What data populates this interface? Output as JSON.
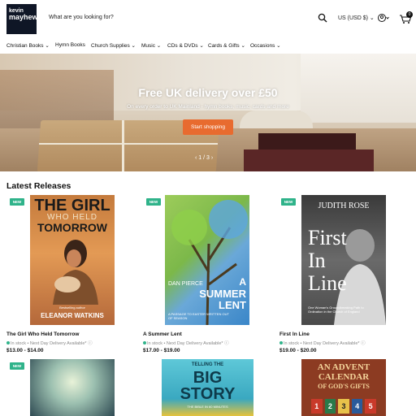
{
  "header": {
    "logo_lines": [
      "kevin",
      "mayhew"
    ],
    "search_placeholder": "What are you looking for?",
    "currency": "US (USD $)",
    "cart_count": "0"
  },
  "nav": [
    {
      "label": "Christian Books ⌄"
    },
    {
      "label": "Hymn Books"
    },
    {
      "label": "Church Supplies ⌄"
    },
    {
      "label": "Music ⌄"
    },
    {
      "label": "CDs & DVDs ⌄"
    },
    {
      "label": "Cards & Gifts ⌄"
    },
    {
      "label": "Occasions ⌄"
    }
  ],
  "hero": {
    "title": "Free UK delivery over £50",
    "subtitle": "On every order to UK Mainland - hymn books, music, cards and more",
    "button": "Start shopping",
    "pager": "1 / 3"
  },
  "latest_releases": {
    "title": "Latest Releases",
    "products": [
      {
        "badge": "NEW",
        "title": "The Girl Who Held Tomorrow",
        "stock": "In stock • Next Day Delivery Available*",
        "price": "$13.00 - $14.00",
        "cover": {
          "line1": "THE GIRL",
          "line2": "WHO HELD",
          "line3": "TOMORROW",
          "author": "ELEANOR WATKINS",
          "tagline": "Bestselling author"
        }
      },
      {
        "badge": "NEW",
        "title": "A Summer Lent",
        "stock": "In stock • Next Day Delivery Available*",
        "price": "$17.00 - $19.00",
        "cover": {
          "author": "DAN PIERCE",
          "line1": "A",
          "line2": "SUMMER",
          "line3": "LENT",
          "tagline": "A PASSAGE TO EASTER WRITTEN OUT OF SEASON"
        }
      },
      {
        "badge": "NEW",
        "title": "First In Line",
        "stock": "In stock • Next Day Delivery Available*",
        "price": "$19.00 - $20.00",
        "cover": {
          "author": "JUDITH ROSE",
          "line1": "First",
          "line2": "In",
          "line3": "Line",
          "tagline": "One Woman's Groundbreaking Path to Ordination in the Church of England"
        }
      }
    ],
    "row2": [
      {
        "badge": "NEW"
      },
      {
        "cover": {
          "line1": "TELLING THE",
          "line2": "BIG",
          "line3": "STORY",
          "tagline": "THE BIBLE IN 60 MINUTES"
        }
      },
      {
        "cover": {
          "line1": "AN ADVENT",
          "line2": "CALENDAR",
          "line3": "OF GOD'S GIFTS",
          "numbers": [
            "1",
            "2",
            "3",
            "4",
            "5"
          ]
        }
      }
    ]
  },
  "colors": {
    "accent": "#e86b2f",
    "badge": "#2fb38a",
    "logo_bg": "#0f1626"
  }
}
